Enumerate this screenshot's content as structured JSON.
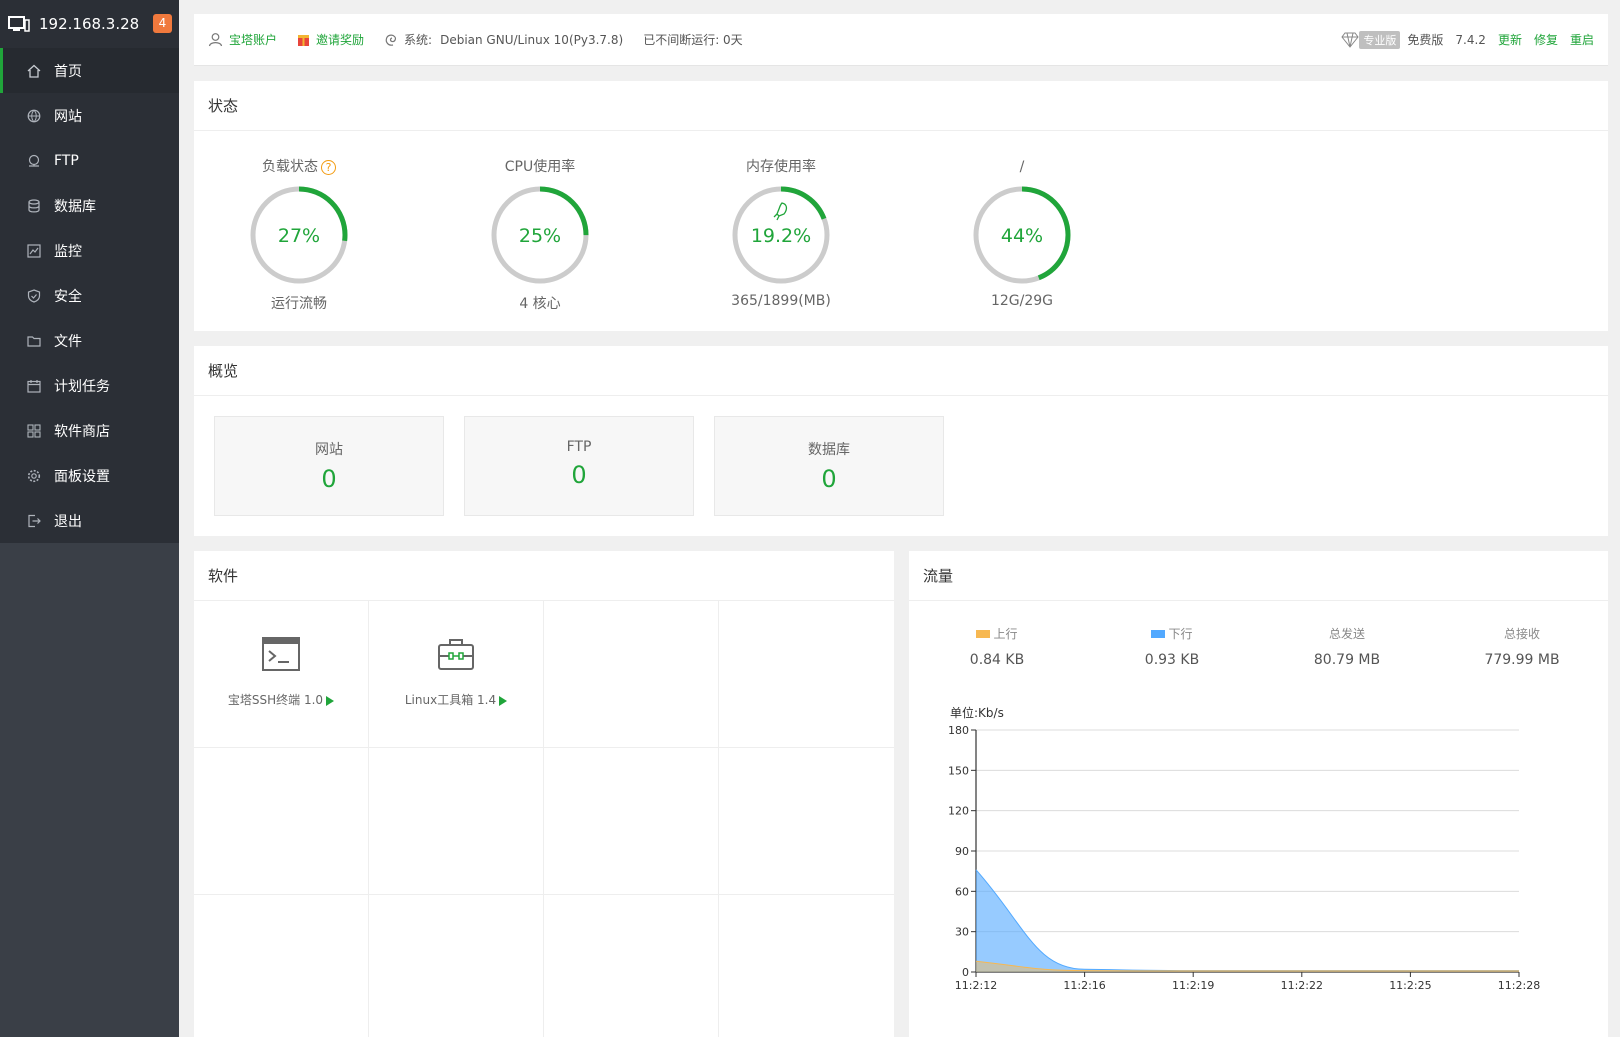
{
  "sidebar": {
    "ip": "192.168.3.28",
    "badge": "4",
    "items": [
      {
        "label": "首页",
        "icon": "home-icon",
        "active": true
      },
      {
        "label": "网站",
        "icon": "globe-icon"
      },
      {
        "label": "FTP",
        "icon": "ftp-icon"
      },
      {
        "label": "数据库",
        "icon": "database-icon"
      },
      {
        "label": "监控",
        "icon": "monitor-icon"
      },
      {
        "label": "安全",
        "icon": "shield-icon"
      },
      {
        "label": "文件",
        "icon": "folder-icon"
      },
      {
        "label": "计划任务",
        "icon": "calendar-icon"
      },
      {
        "label": "软件商店",
        "icon": "grid-icon"
      },
      {
        "label": "面板设置",
        "icon": "gear-icon"
      },
      {
        "label": "退出",
        "icon": "logout-icon"
      }
    ]
  },
  "topbar": {
    "account": "宝塔账户",
    "invite": "邀请奖励",
    "system_label": "系统:",
    "system_value": "Debian GNU/Linux 10(Py3.7.8)",
    "uptime": "已不间断运行: 0天",
    "pro_tag": "专业版",
    "edition": "免费版",
    "version": "7.4.2",
    "update": "更新",
    "repair": "修复",
    "restart": "重启"
  },
  "status": {
    "title": "状态",
    "gauges": [
      {
        "title": "负载状态",
        "value": "27%",
        "percent": 27,
        "sub": "运行流畅",
        "help": "?"
      },
      {
        "title": "CPU使用率",
        "value": "25%",
        "percent": 25,
        "sub": "4 核心"
      },
      {
        "title": "内存使用率",
        "value": "19.2%",
        "percent": 19.2,
        "sub": "365/1899(MB)"
      },
      {
        "title": "/",
        "value": "44%",
        "percent": 44,
        "sub": "12G/29G"
      }
    ]
  },
  "overview": {
    "title": "概览",
    "boxes": [
      {
        "label": "网站",
        "value": "0"
      },
      {
        "label": "FTP",
        "value": "0"
      },
      {
        "label": "数据库",
        "value": "0"
      }
    ]
  },
  "software": {
    "title": "软件",
    "items": [
      {
        "name": "宝塔SSH终端 1.0",
        "icon": "terminal-icon"
      },
      {
        "name": "Linux工具箱 1.4",
        "icon": "toolbox-icon"
      }
    ]
  },
  "traffic": {
    "title": "流量",
    "stats": [
      {
        "label": "上行",
        "value": "0.84 KB",
        "color": "#f7b851"
      },
      {
        "label": "下行",
        "value": "0.93 KB",
        "color": "#52a9ff"
      },
      {
        "label": "总发送",
        "value": "80.79 MB"
      },
      {
        "label": "总接收",
        "value": "779.99 MB"
      }
    ]
  },
  "chart_data": {
    "type": "area",
    "ylabel": "单位:Kb/s",
    "ylim": [
      0,
      180
    ],
    "yticks": [
      "0",
      "30",
      "60",
      "90",
      "120",
      "150",
      "180"
    ],
    "x": [
      "11:2:12",
      "11:2:16",
      "11:2:19",
      "11:2:22",
      "11:2:25",
      "11:2:28"
    ],
    "series": [
      {
        "name": "下行",
        "color": "#52a9ff",
        "points": [
          [
            0,
            76
          ],
          [
            1,
            2
          ],
          [
            2,
            1
          ],
          [
            3,
            1
          ],
          [
            4,
            1
          ],
          [
            5,
            1
          ]
        ]
      },
      {
        "name": "上行",
        "color": "#f7b851",
        "points": [
          [
            0,
            8
          ],
          [
            1,
            1
          ],
          [
            2,
            0.8
          ],
          [
            3,
            0.8
          ],
          [
            4,
            0.8
          ],
          [
            5,
            0.8
          ]
        ]
      }
    ]
  }
}
